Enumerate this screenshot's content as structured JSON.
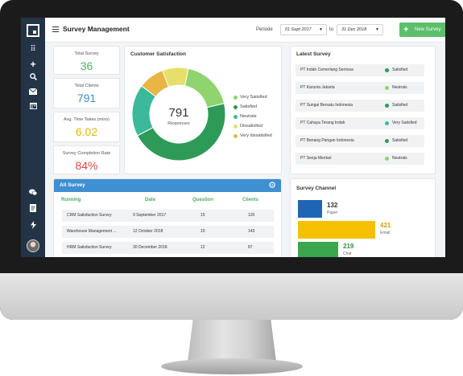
{
  "header": {
    "title": "Survey Management",
    "periode_label": "Periode",
    "date_from": "01 Sept 2017",
    "to_label": "to",
    "date_to": "31 Dec 2018",
    "new_survey_label": "New Survey"
  },
  "stats": {
    "total_survey": {
      "label": "Total Survey",
      "value": "36",
      "color": "#4caf64"
    },
    "total_clients": {
      "label": "Total Clients",
      "value": "791",
      "color": "#3b8fd0"
    },
    "avg_time": {
      "label": "Avg. Time Takes (mins)",
      "value": "6.02",
      "color": "#e6b800"
    },
    "completion": {
      "label": "Survey Completion Rate",
      "value": "84%",
      "color": "#e0483e"
    }
  },
  "satisfaction": {
    "title": "Customer Satisfaction",
    "center_value": "791",
    "center_label": "Responses",
    "slices": [
      {
        "name": "Very Satisfied",
        "value": 18,
        "color": "#8fd46e"
      },
      {
        "name": "Satisfied",
        "value": 46,
        "color": "#2e9a58"
      },
      {
        "name": "Neutrals",
        "value": 18,
        "color": "#3cb99a"
      },
      {
        "name": "Dissatisfied",
        "value": 9,
        "color": "#e9b545"
      },
      {
        "name": "Very dissatisfied",
        "value": 9,
        "color": "#e6e06a"
      }
    ],
    "legend": [
      {
        "name": "Very Satisfied",
        "color": "#8fd46e"
      },
      {
        "name": "Satisfied",
        "color": "#2e9a58"
      },
      {
        "name": "Neutrals",
        "color": "#3cb99a"
      },
      {
        "name": "Dissatisfied",
        "color": "#e6e06a"
      },
      {
        "name": "Very dissatisfied",
        "color": "#e9b545"
      }
    ]
  },
  "latest": {
    "title": "Latest Survey",
    "rows": [
      {
        "company": "PT Indah Cemerlang Sentosa",
        "status": "Satisfied",
        "color": "#2e9a58"
      },
      {
        "company": "PT Karunia Jakarta",
        "status": "Neutrals",
        "color": "#8fd46e"
      },
      {
        "company": "PT Sungai Bersatu Indonesia",
        "status": "Satisfied",
        "color": "#2e9a58"
      },
      {
        "company": "PT Cahaya Terang Indah",
        "status": "Very Satisfied",
        "color": "#3cb99a"
      },
      {
        "company": "PT Benang Pangan Indonesia",
        "status": "Satisfied",
        "color": "#2e9a58"
      },
      {
        "company": "PT Senja Mentari",
        "status": "Neutrals",
        "color": "#8fd46e"
      }
    ]
  },
  "all_survey": {
    "title": "All Survey",
    "columns": [
      "Running",
      "Date",
      "Question",
      "Clients"
    ],
    "rows": [
      {
        "name": "CRM Satisfaction Survey",
        "date": "9 September 2017",
        "question": "15",
        "clients": "120"
      },
      {
        "name": "Warehouse Management ...",
        "date": "12 October 2018",
        "question": "10",
        "clients": "143"
      },
      {
        "name": "HRM Satisfaction Survey",
        "date": "30 December 2018",
        "question": "12",
        "clients": "87"
      }
    ]
  },
  "channel": {
    "title": "Survey Channel",
    "bars": [
      {
        "name": "Paper",
        "value": 132,
        "color": "#1f65b5"
      },
      {
        "name": "Email",
        "value": 421,
        "color": "#f5c000"
      },
      {
        "name": "Chat",
        "value": 219,
        "color": "#3aa64d"
      }
    ]
  },
  "chart_data": {
    "type": "pie",
    "title": "Customer Satisfaction",
    "labels": [
      "Very Satisfied",
      "Satisfied",
      "Neutrals",
      "Dissatisfied",
      "Very dissatisfied"
    ],
    "values": [
      18,
      46,
      18,
      9,
      9
    ],
    "legend": "right"
  }
}
